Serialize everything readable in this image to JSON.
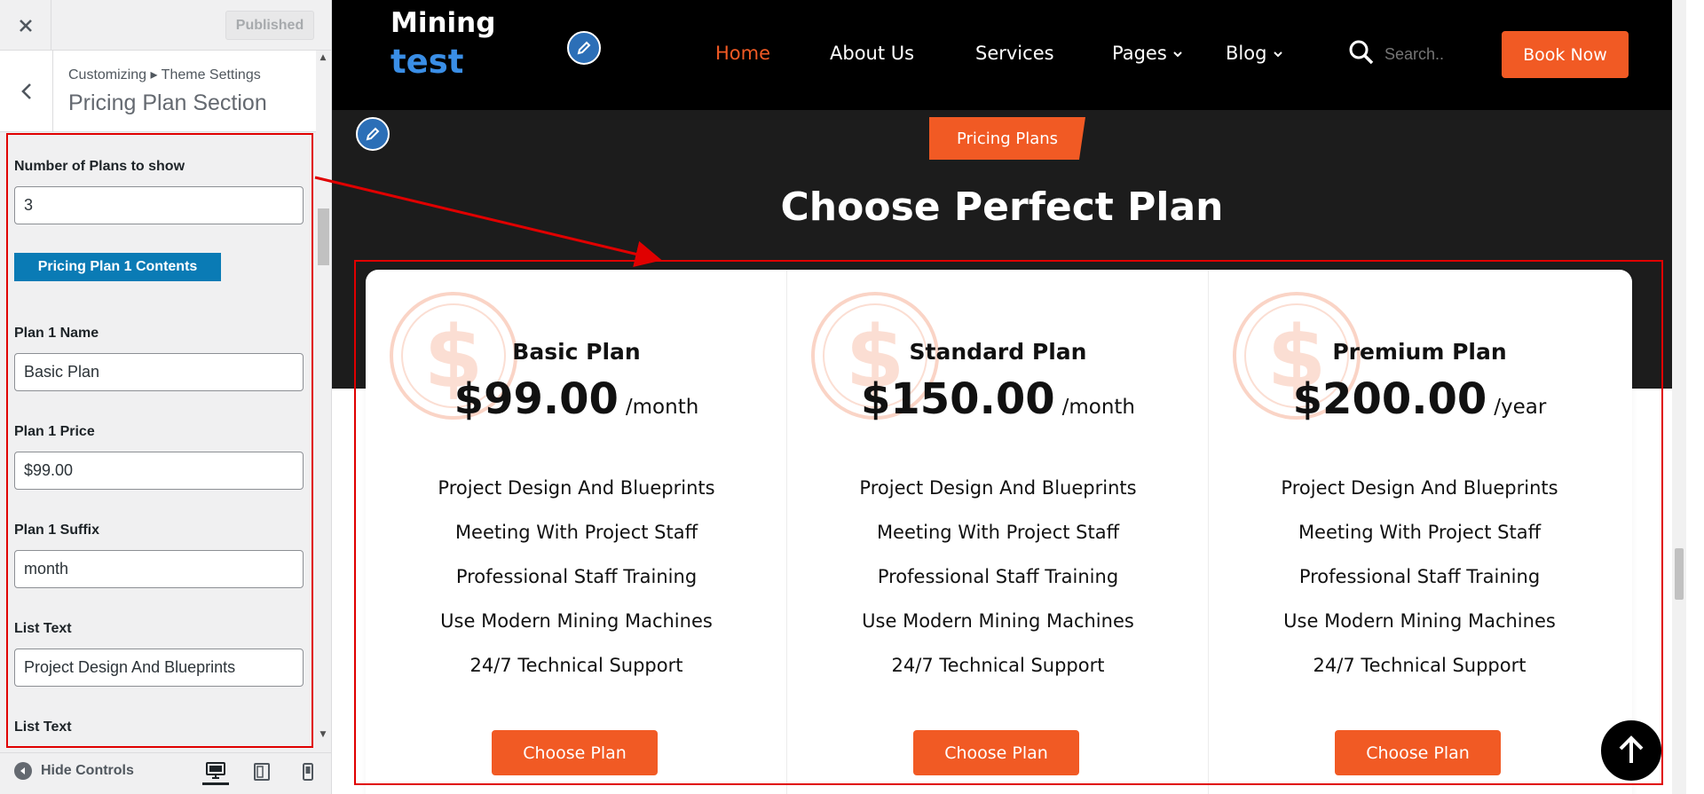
{
  "sidebar": {
    "close_icon": "close-icon",
    "status_button": "Published",
    "breadcrumb": "Customizing ▸ Theme Settings",
    "section_title": "Pricing Plan Section",
    "controls": {
      "num_plans_label": "Number of Plans to show",
      "num_plans_value": "3",
      "group_button": "Pricing Plan 1 Contents",
      "plan_name_label": "Plan 1 Name",
      "plan_name_value": "Basic Plan",
      "plan_price_label": "Plan 1 Price",
      "plan_price_value": "$99.00",
      "plan_suffix_label": "Plan 1 Suffix",
      "plan_suffix_value": "month",
      "list_text_label": "List Text",
      "list_text_value": "Project Design And Blueprints",
      "list_text_label_2": "List Text"
    },
    "footer": {
      "hide_controls": "Hide Controls",
      "devices": [
        "desktop",
        "tablet",
        "mobile"
      ]
    }
  },
  "site": {
    "logo_line1": "Mining",
    "logo_line2": "test",
    "nav": {
      "home": "Home",
      "about": "About Us",
      "services": "Services",
      "pages": "Pages",
      "blog": "Blog"
    },
    "search_placeholder": "Search..",
    "book_button": "Book Now",
    "accent_color": "#f15a24",
    "logo_accent": "#3a8ee6"
  },
  "pricing": {
    "badge": "Pricing Plans",
    "title": "Choose Perfect Plan",
    "plans": [
      {
        "name": "Basic Plan",
        "price": "$99.00",
        "suffix": "/month",
        "features": [
          "Project Design And Blueprints",
          "Meeting With Project Staff",
          "Professional Staff Training",
          "Use Modern Mining Machines",
          "24/7 Technical Support"
        ],
        "button": "Choose Plan"
      },
      {
        "name": "Standard Plan",
        "price": "$150.00",
        "suffix": "/month",
        "features": [
          "Project Design And Blueprints",
          "Meeting With Project Staff",
          "Professional Staff Training",
          "Use Modern Mining Machines",
          "24/7 Technical Support"
        ],
        "button": "Choose Plan"
      },
      {
        "name": "Premium Plan",
        "price": "$200.00",
        "suffix": "/year",
        "features": [
          "Project Design And Blueprints",
          "Meeting With Project Staff",
          "Professional Staff Training",
          "Use Modern Mining Machines",
          "24/7 Technical Support"
        ],
        "button": "Choose Plan"
      }
    ]
  }
}
